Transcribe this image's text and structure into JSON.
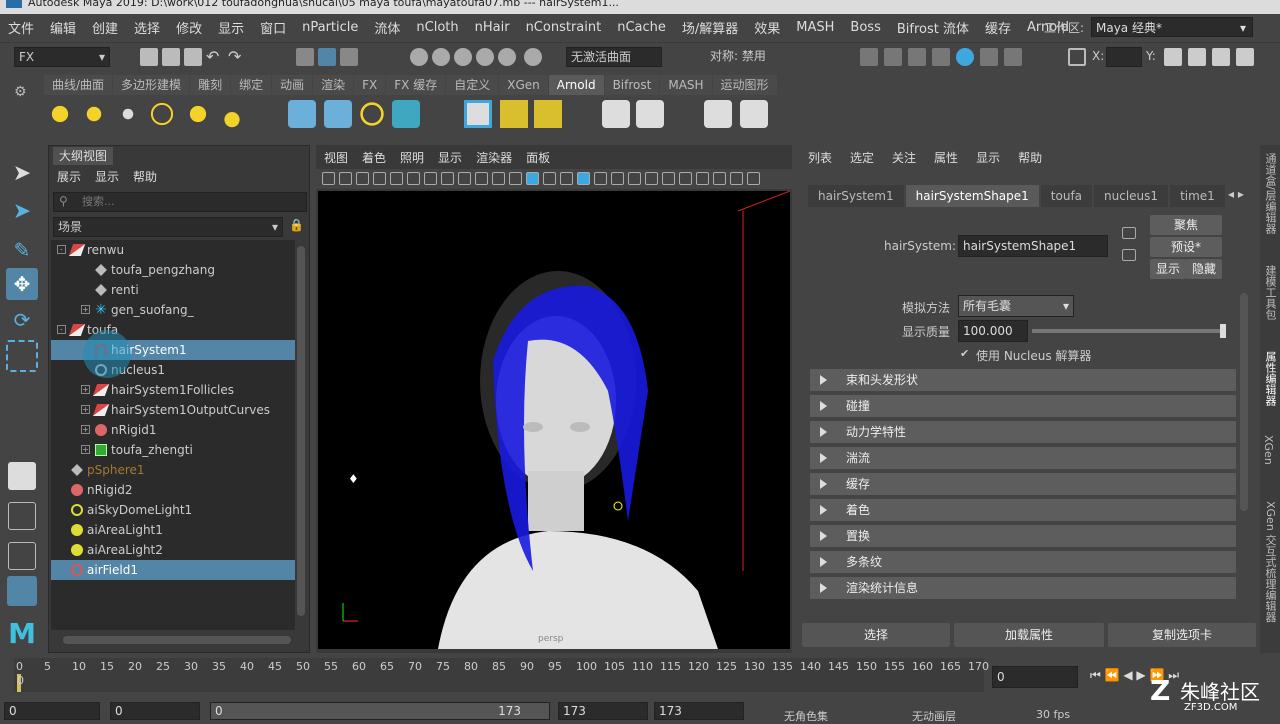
{
  "titlebar": {
    "text": "Autodesk Maya 2019: D:\\work\\012 toufadonghua\\shucai\\05 maya toufa\\mayatoufa07.mb    ---    hairSystem1..."
  },
  "menu": [
    "文件",
    "编辑",
    "创建",
    "选择",
    "修改",
    "显示",
    "窗口",
    "nParticle",
    "流体",
    "nCloth",
    "nHair",
    "nConstraint",
    "nCache",
    "场/解算器",
    "效果",
    "MASH",
    "Boss",
    "Bifrost 流体",
    "缓存",
    "Arnold"
  ],
  "workspace": {
    "label": "工作区:",
    "value": "Maya 经典*"
  },
  "status": {
    "mode": "FX",
    "no_live": "无激活曲面",
    "symmetry": "对称: 禁用",
    "x_label": "X:",
    "y_label": "Y:"
  },
  "shelf_tabs": [
    "曲线/曲面",
    "多边形建模",
    "雕刻",
    "绑定",
    "动画",
    "渲染",
    "FX",
    "FX 缓存",
    "自定义",
    "XGen",
    "Arnold",
    "Bifrost",
    "MASH",
    "运动图形"
  ],
  "shelf_active": "Arnold",
  "outliner": {
    "title": "大纲视图",
    "menu": [
      "展示",
      "显示",
      "帮助"
    ],
    "search_placeholder": "搜索...",
    "scene": "场景",
    "items": [
      {
        "label": "renwu",
        "indent": 0,
        "icon": "transform-icon",
        "exp": "-"
      },
      {
        "label": "toufa_pengzhang",
        "indent": 1,
        "icon": "blendshape-icon",
        "exp": ""
      },
      {
        "label": "renti",
        "indent": 1,
        "icon": "blendshape-icon",
        "exp": ""
      },
      {
        "label": "gen_suofang_",
        "indent": 1,
        "icon": "joint-icon",
        "exp": "+"
      },
      {
        "label": "toufa",
        "indent": 0,
        "icon": "transform-icon",
        "exp": "-"
      },
      {
        "label": "hairSystem1",
        "indent": 1,
        "icon": "hair-icon",
        "exp": "",
        "sel": true
      },
      {
        "label": "nucleus1",
        "indent": 1,
        "icon": "nucleus-icon",
        "exp": ""
      },
      {
        "label": "hairSystem1Follicles",
        "indent": 1,
        "icon": "transform-icon",
        "exp": "+"
      },
      {
        "label": "hairSystem1OutputCurves",
        "indent": 1,
        "icon": "transform-icon",
        "exp": "+"
      },
      {
        "label": "nRigid1",
        "indent": 1,
        "icon": "nrigid-icon",
        "exp": "+"
      },
      {
        "label": "toufa_zhengti",
        "indent": 1,
        "icon": "mesh-icon",
        "exp": "+"
      },
      {
        "label": "pSphere1",
        "indent": 0,
        "icon": "blendshape-icon",
        "exp": "",
        "dim": true
      },
      {
        "label": "nRigid2",
        "indent": 0,
        "icon": "nrigid-icon",
        "exp": ""
      },
      {
        "label": "aiSkyDomeLight1",
        "indent": 0,
        "icon": "skydome-icon",
        "exp": ""
      },
      {
        "label": "aiAreaLight1",
        "indent": 0,
        "icon": "arealight-icon",
        "exp": ""
      },
      {
        "label": "aiAreaLight2",
        "indent": 0,
        "icon": "arealight-icon",
        "exp": ""
      },
      {
        "label": "airField1",
        "indent": 0,
        "icon": "airfield-icon",
        "exp": "",
        "sel": true
      }
    ]
  },
  "viewport": {
    "menu": [
      "视图",
      "着色",
      "照明",
      "显示",
      "渲染器",
      "面板"
    ],
    "persp": "persp"
  },
  "attr": {
    "menu": [
      "列表",
      "选定",
      "关注",
      "属性",
      "显示",
      "帮助"
    ],
    "tabs": [
      "hairSystem1",
      "hairSystemShape1",
      "toufa",
      "nucleus1",
      "time1"
    ],
    "active_tab": "hairSystemShape1",
    "node_label": "hairSystem:",
    "node_value": "hairSystemShape1",
    "focus": "聚焦",
    "presets": "预设*",
    "show": "显示",
    "hide": "隐藏",
    "sim_label": "模拟方法",
    "sim_value": "所有毛囊",
    "quality_label": "显示质量",
    "quality_value": "100.000",
    "quality_fraction": 1.0,
    "nucleus_check": "使用 Nucleus 解算器",
    "sections": [
      "束和头发形状",
      "碰撞",
      "动力学特性",
      "湍流",
      "缓存",
      "着色",
      "置换",
      "多条纹",
      "渲染统计信息"
    ],
    "bottom": [
      "选择",
      "加载属性",
      "复制选项卡"
    ]
  },
  "sidetabs": [
    "通道盒/层编辑器",
    "建模工具包",
    "属性编辑器",
    "XGen",
    "XGen 交互式梳理编辑器"
  ],
  "timeline": {
    "ticks": [
      "0",
      "5",
      "10",
      "15",
      "20",
      "25",
      "30",
      "35",
      "40",
      "45",
      "50",
      "55",
      "60",
      "65",
      "70",
      "75",
      "80",
      "85",
      "90",
      "95",
      "100",
      "105",
      "110",
      "115",
      "120",
      "125",
      "130",
      "135",
      "140",
      "145",
      "150",
      "155",
      "160",
      "165",
      "170"
    ],
    "current": "0",
    "frame_field": "0"
  },
  "range": {
    "start": "0",
    "start2": "0",
    "min": "0",
    "max": "173",
    "end": "173",
    "end2": "173",
    "char": "无角色集",
    "anim": "无动画层",
    "fps": "30 fps"
  },
  "watermark": "朱峰社区",
  "watermark_url": "ZF3D.COM"
}
